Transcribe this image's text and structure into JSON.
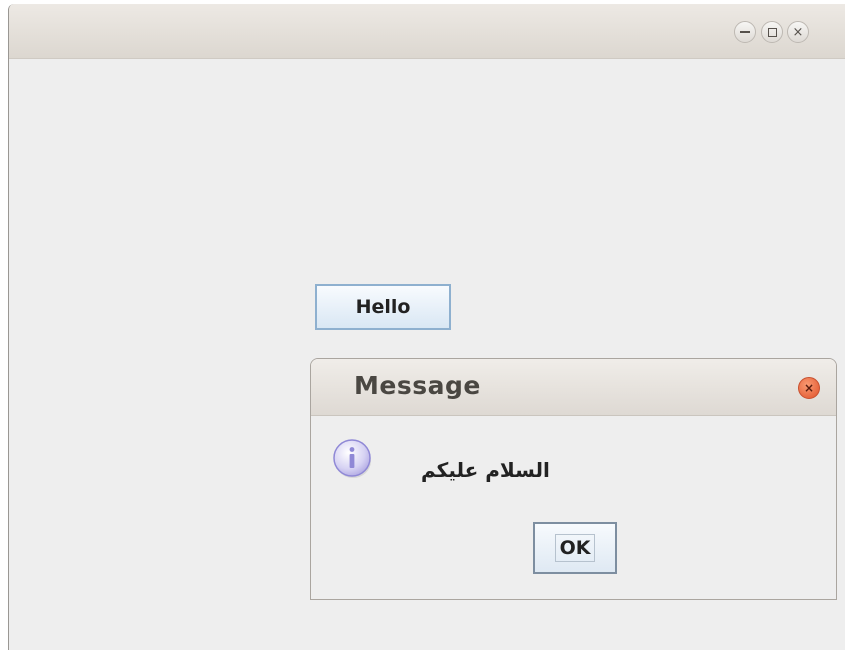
{
  "window": {
    "controls": {
      "minimize_icon": "minimize-icon",
      "maximize_icon": "maximize-icon",
      "close_icon": "close-icon",
      "close_glyph": "×"
    }
  },
  "main": {
    "hello_button_label": "Hello"
  },
  "dialog": {
    "title": "Message",
    "close_glyph": "×",
    "icon": "info-icon",
    "message": "السلام عليكم",
    "ok_label": "OK"
  },
  "colors": {
    "accent_button_border": "#8eb0cf",
    "dialog_close": "#e0522a",
    "info_icon": "#8f88d6"
  }
}
